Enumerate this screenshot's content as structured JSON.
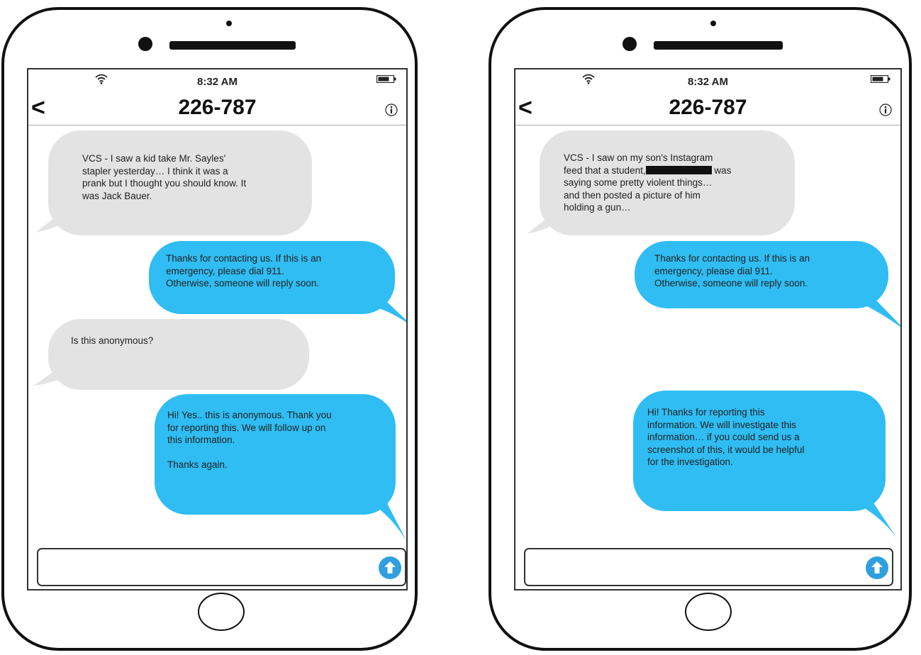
{
  "phones": [
    {
      "status": {
        "time": "8:32 AM"
      },
      "header": {
        "contact": "226-787",
        "back_glyph": "<"
      },
      "messages": [
        {
          "direction": "incoming",
          "text": "VCS - I saw a kid take Mr. Sayles'\nstapler yesterday… I think it was a\nprank but I thought you should know. It\nwas Jack Bauer."
        },
        {
          "direction": "outgoing",
          "text": "Thanks for contacting us. If this is an\nemergency, please dial 911.\nOtherwise, someone will reply soon."
        },
        {
          "direction": "incoming",
          "text": "Is this anonymous?"
        },
        {
          "direction": "outgoing",
          "text": "Hi! Yes.. this is anonymous. Thank you\nfor reporting this.  We will follow up on\nthis information.\n\nThanks again."
        }
      ],
      "compose": {
        "value": ""
      }
    },
    {
      "status": {
        "time": "8:32 AM"
      },
      "header": {
        "contact": "226-787",
        "back_glyph": "<"
      },
      "messages": [
        {
          "direction": "incoming",
          "text_before": "VCS - I saw on my son's Instagram\nfeed that a student,",
          "text_after": " was\nsaying some pretty violent things…\nand then posted a picture of him\nholding a gun…"
        },
        {
          "direction": "outgoing",
          "text": "Thanks for contacting us. If this is an\nemergency, please dial 911.\nOtherwise, someone will reply soon."
        },
        {
          "direction": "outgoing",
          "text": "Hi! Thanks for reporting this\ninformation. We will investigate this\ninformation… if you could send us  a\nscreenshot of this, it would be helpful\nfor the investigation."
        }
      ],
      "compose": {
        "value": ""
      }
    }
  ],
  "icons": {
    "wifi": "wifi-icon",
    "battery": "battery-icon",
    "info": "info-icon",
    "send": "send-arrow-icon",
    "back": "chevron-left-icon"
  },
  "colors": {
    "incoming_bubble": "#e3e3e3",
    "outgoing_bubble": "#2fbdf3",
    "send_button": "#2f9fe0"
  }
}
